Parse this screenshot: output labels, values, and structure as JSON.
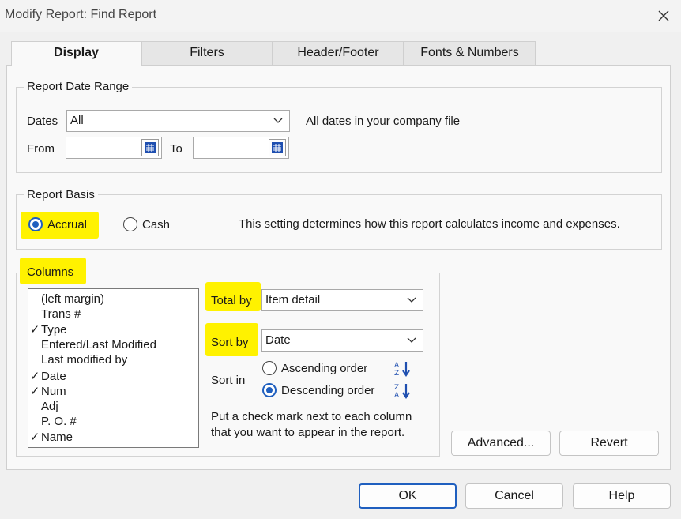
{
  "window": {
    "title": "Modify Report: Find Report"
  },
  "tabs": [
    {
      "label": "Display",
      "active": true
    },
    {
      "label": "Filters",
      "active": false
    },
    {
      "label": "Header/Footer",
      "active": false
    },
    {
      "label": "Fonts & Numbers",
      "active": false
    }
  ],
  "date_range": {
    "group_label": "Report Date Range",
    "dates_label": "Dates",
    "dates_value": "All",
    "dates_note": "All dates in your company file",
    "from_label": "From",
    "from_value": "",
    "to_label": "To",
    "to_value": ""
  },
  "report_basis": {
    "group_label": "Report Basis",
    "accrual_label": "Accrual",
    "cash_label": "Cash",
    "selected": "Accrual",
    "note": "This setting determines how this report calculates income and expenses."
  },
  "columns": {
    "group_label": "Columns",
    "items": [
      {
        "label": "(left margin)",
        "checked": false
      },
      {
        "label": "Trans #",
        "checked": false
      },
      {
        "label": "Type",
        "checked": true
      },
      {
        "label": "Entered/Last Modified",
        "checked": false
      },
      {
        "label": "Last modified by",
        "checked": false
      },
      {
        "label": "Date",
        "checked": true
      },
      {
        "label": "Num",
        "checked": true
      },
      {
        "label": "Adj",
        "checked": false
      },
      {
        "label": "P. O. #",
        "checked": false
      },
      {
        "label": "Name",
        "checked": true
      }
    ],
    "total_by_label": "Total by",
    "total_by_value": "Item detail",
    "sort_by_label": "Sort by",
    "sort_by_value": "Date",
    "sort_in_label": "Sort in",
    "ascending_label": "Ascending order",
    "descending_label": "Descending order",
    "sort_order_selected": "Descending order",
    "help_text_1": "Put a check mark next to each column",
    "help_text_2": "that you want to appear in the report."
  },
  "buttons": {
    "advanced": "Advanced...",
    "revert": "Revert",
    "ok": "OK",
    "cancel": "Cancel",
    "help": "Help"
  },
  "colors": {
    "highlight": "#fff200",
    "accent": "#1f5fbf"
  }
}
